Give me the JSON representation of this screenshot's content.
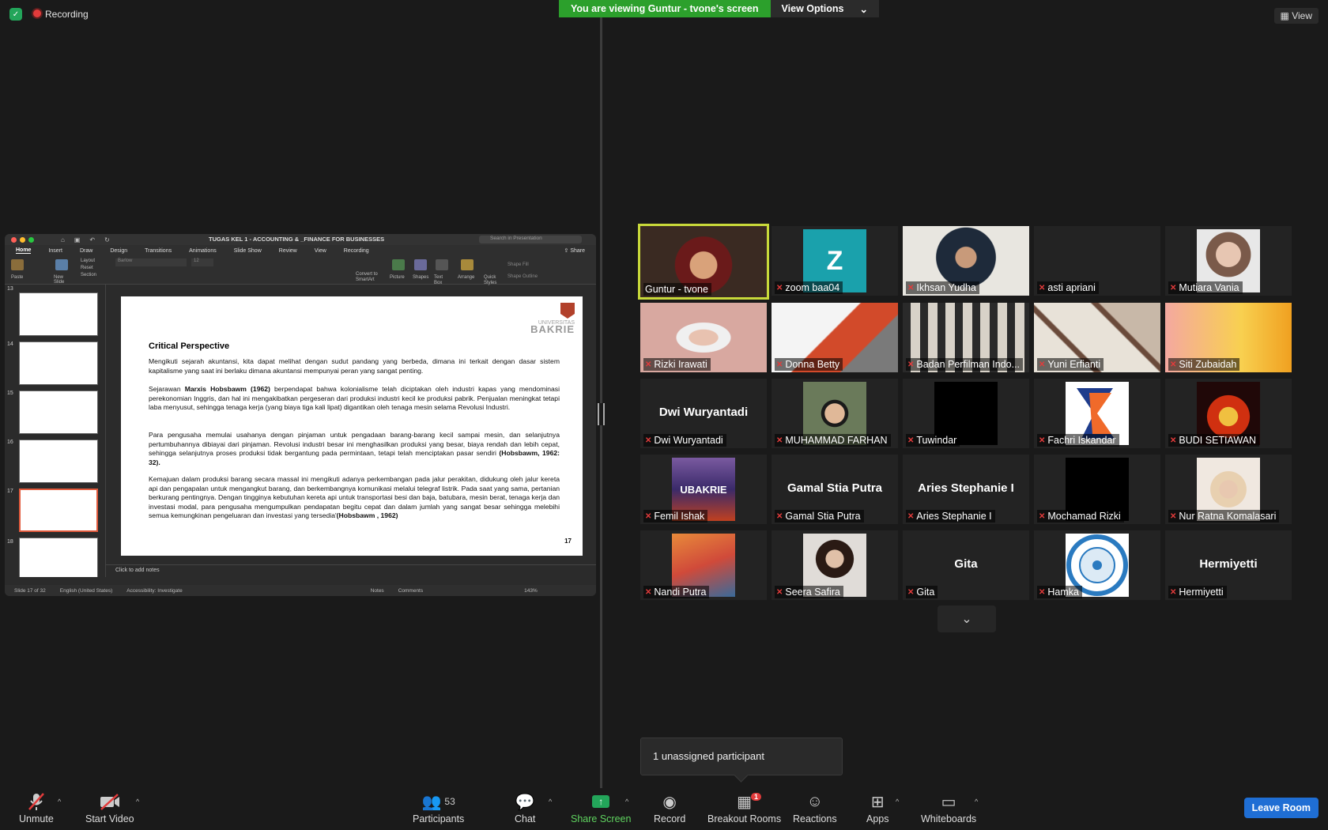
{
  "top": {
    "recording_label": "Recording",
    "viewing_banner": "You are viewing Guntur - tvone's screen",
    "view_options": "View Options",
    "view_label": "View"
  },
  "shared_screen": {
    "window_title": "TUGAS KEL 1 - ACCOUNTING & _FINANCE FOR BUSINESSES",
    "search_placeholder": "Search in Presentation",
    "share_label": "Share",
    "tabs": [
      "Home",
      "Insert",
      "Draw",
      "Design",
      "Transitions",
      "Animations",
      "Slide Show",
      "Review",
      "View",
      "Recording"
    ],
    "ribbon": {
      "paste": "Paste",
      "layout": "Layout",
      "reset": "Reset",
      "section": "Section",
      "new_slide": "New Slide",
      "font": "Barlow",
      "size": "12",
      "convert": "Convert to SmartArt",
      "picture": "Picture",
      "shapes": "Shapes",
      "text_box": "Text Box",
      "arrange": "Arrange",
      "quick_styles": "Quick Styles",
      "shape_fill": "Shape Fill",
      "shape_outline": "Shape Outline"
    },
    "thumbnails": [
      "13",
      "14",
      "15",
      "16",
      "17",
      "18"
    ],
    "slide": {
      "logo_top": "UNIVERSITAS",
      "logo_bottom": "BAKRIE",
      "title": "Critical Perspective",
      "p1": "Mengikuti  sejarah akuntansi, kita dapat melihat dengan sudut pandang yang berbeda, dimana ini terkait dengan dasar sistem kapitalisme yang saat ini berlaku dimana akuntansi mempunyai peran yang sangat penting.",
      "p2_pre": "Sejarawan ",
      "p2_bold": "Marxis Hobsbawm (1962)",
      "p2_post": " berpendapat bahwa kolonialisme telah diciptakan oleh industri kapas yang mendominasi perekonomian Inggris, dan hal ini mengakibatkan pergeseran dari produksi industri kecil ke produksi pabrik. Penjualan meningkat tetapi laba menyusut, sehingga tenaga kerja (yang biaya tiga kali lipat) digantikan oleh tenaga mesin selama Revolusi Industri.",
      "p3": "Para pengusaha memulai usahanya dengan pinjaman untuk pengadaan barang-barang kecil sampai mesin, dan selanjutnya pertumbuhannya dibiayai dari pinjaman. Revolusi industri besar ini menghasilkan produksi yang besar, biaya rendah dan lebih cepat, sehingga selanjutnya proses produksi tidak bergantung pada permintaan, tetapi telah menciptakan pasar sendiri",
      "p3_bold": "(Hobsbawm, 1962: 32).",
      "p4": "Kemajuan dalam produksi barang secara massal ini mengikuti adanya perkembangan pada jalur perakitan, didukung oleh jalur kereta api dan pengapalan untuk mengangkut barang, dan berkembangnya komunikasi melalui telegraf listrik. Pada saat yang sama, pertanian berkurang pentingnya. Dengan tingginya kebutuhan kereta api untuk transportasi besi dan baja, batubara, mesin berat, tenaga kerja dan investasi modal, para pengusaha mengumpulkan pendapatan begitu cepat dan dalam jumlah yang sangat besar sehingga melebihi semua kemungkinan pengeluaran dan investasi yang tersedia'",
      "p4_bold": "(Hobsbawm , 1962)",
      "page_number": "17"
    },
    "notes_placeholder": "Click to add notes",
    "status": {
      "slide": "Slide 17 of 32",
      "language": "English (United States)",
      "accessibility": "Accessibility: Investigate",
      "notes": "Notes",
      "comments": "Comments",
      "zoom": "143%"
    }
  },
  "gallery": [
    {
      "name": "Guntur - tvone",
      "big": "",
      "muted": false,
      "active": true
    },
    {
      "name": "zoom baa04",
      "big": "",
      "muted": true,
      "avatar_letter": "Z"
    },
    {
      "name": "Ikhsan Yudha",
      "big": "",
      "muted": true
    },
    {
      "name": "asti apriani",
      "big": "",
      "muted": true
    },
    {
      "name": "Mutiara Vania",
      "big": "",
      "muted": true
    },
    {
      "name": "Rizki Irawati",
      "big": "",
      "muted": true
    },
    {
      "name": "Donna Betty",
      "big": "",
      "muted": true
    },
    {
      "name": "Badan Perfilman Indo...",
      "big": "",
      "muted": true
    },
    {
      "name": "Yuni Erfianti",
      "big": "",
      "muted": true
    },
    {
      "name": "Siti Zubaidah",
      "big": "",
      "muted": true
    },
    {
      "name": "Dwi Wuryantadi",
      "big": "Dwi Wuryantadi",
      "muted": true
    },
    {
      "name": "MUHAMMAD FARHAN",
      "big": "",
      "muted": true
    },
    {
      "name": "Tuwindar",
      "big": "",
      "muted": true
    },
    {
      "name": "Fachri Iskandar",
      "big": "",
      "muted": true
    },
    {
      "name": "BUDI SETIAWAN",
      "big": "",
      "muted": true
    },
    {
      "name": "Femil Ishak",
      "big": "",
      "muted": true,
      "img_text": "UBAKRIE"
    },
    {
      "name": "Gamal Stia Putra",
      "big": "Gamal Stia Putra",
      "muted": true
    },
    {
      "name": "Aries Stephanie I",
      "big": "Aries Stephanie I",
      "muted": true
    },
    {
      "name": "Mochamad Rizki",
      "big": "",
      "muted": true
    },
    {
      "name": "Nur Ratna Komalasari",
      "big": "",
      "muted": true
    },
    {
      "name": "Nandi Putra",
      "big": "",
      "muted": true
    },
    {
      "name": "Seera Safira",
      "big": "",
      "muted": true
    },
    {
      "name": "Gita",
      "big": "Gita",
      "muted": true
    },
    {
      "name": "Hamka",
      "big": "",
      "muted": true
    },
    {
      "name": "Hermiyetti",
      "big": "Hermiyetti",
      "muted": true
    }
  ],
  "unassigned": "1 unassigned participant",
  "toolbar": {
    "unmute": "Unmute",
    "start_video": "Start Video",
    "participants": "Participants",
    "participants_count": "53",
    "chat": "Chat",
    "share_screen": "Share Screen",
    "record": "Record",
    "breakout": "Breakout Rooms",
    "breakout_badge": "1",
    "reactions": "Reactions",
    "apps": "Apps",
    "whiteboards": "Whiteboards",
    "leave": "Leave Room"
  },
  "colors": {
    "active_speaker": "#c8d93a",
    "banner_green": "#2ca02c",
    "leave_blue": "#1f6ed4",
    "mute_red": "#e23b3b"
  }
}
